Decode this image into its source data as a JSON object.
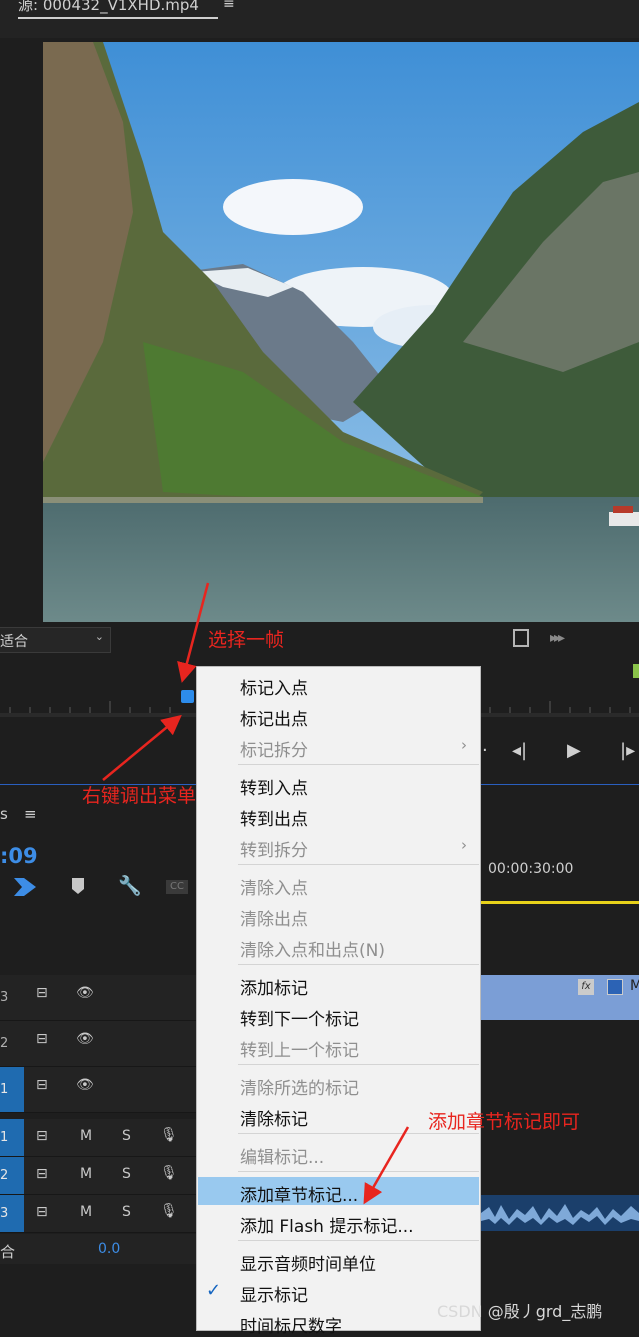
{
  "source_tab": {
    "title": "源: 000432_V1XHD.mp4",
    "menu_icon": "hamburger-icon"
  },
  "monitor": {
    "fit_label": "适合"
  },
  "timeline": {
    "title": "s",
    "current_time": ":09",
    "ruler_time": "00:00:30:00",
    "bottom_fit": "合",
    "bottom_value": "0.0",
    "tracks": [
      {
        "num": "3",
        "mute": "",
        "solo": ""
      },
      {
        "num": "2",
        "mute": "",
        "solo": ""
      },
      {
        "num": "1",
        "mute": "",
        "solo": ""
      },
      {
        "num": "1",
        "mute": "M",
        "solo": "S"
      },
      {
        "num": "2",
        "mute": "M",
        "solo": "S"
      },
      {
        "num": "3",
        "mute": "M",
        "solo": "S"
      }
    ],
    "clip_name": "M"
  },
  "context_menu": {
    "items": [
      {
        "label": "标记入点",
        "disabled": false
      },
      {
        "label": "标记出点",
        "disabled": false
      },
      {
        "label": "标记拆分",
        "disabled": true,
        "submenu": true
      },
      {
        "label": "转到入点",
        "disabled": false
      },
      {
        "label": "转到出点",
        "disabled": false
      },
      {
        "label": "转到拆分",
        "disabled": true,
        "submenu": true
      },
      {
        "label": "清除入点",
        "disabled": true
      },
      {
        "label": "清除出点",
        "disabled": true
      },
      {
        "label": "清除入点和出点(N)",
        "disabled": true
      },
      {
        "label": "添加标记",
        "disabled": false
      },
      {
        "label": "转到下一个标记",
        "disabled": false
      },
      {
        "label": "转到上一个标记",
        "disabled": true
      },
      {
        "label": "清除所选的标记",
        "disabled": true
      },
      {
        "label": "清除标记",
        "disabled": false
      },
      {
        "label": "编辑标记...",
        "disabled": true
      },
      {
        "label": "添加章节标记...",
        "disabled": false,
        "highlighted": true
      },
      {
        "label": "添加 Flash 提示标记...",
        "disabled": false
      },
      {
        "label": "显示音频时间单位",
        "disabled": false
      },
      {
        "label": "显示标记",
        "disabled": false,
        "checked": true
      },
      {
        "label": "时间标尺数字",
        "disabled": false
      }
    ]
  },
  "annotations": {
    "select_frame": "选择一帧",
    "right_click": "右键调出菜单",
    "add_chapter": "添加章节标记即可",
    "color": "#e8251f"
  },
  "watermark": "CSDN @殷丿grd_志鹏",
  "colors": {
    "accent_blue": "#2d8ceb",
    "menu_highlight": "#99c9ef",
    "work_area": "#e8d21a"
  }
}
